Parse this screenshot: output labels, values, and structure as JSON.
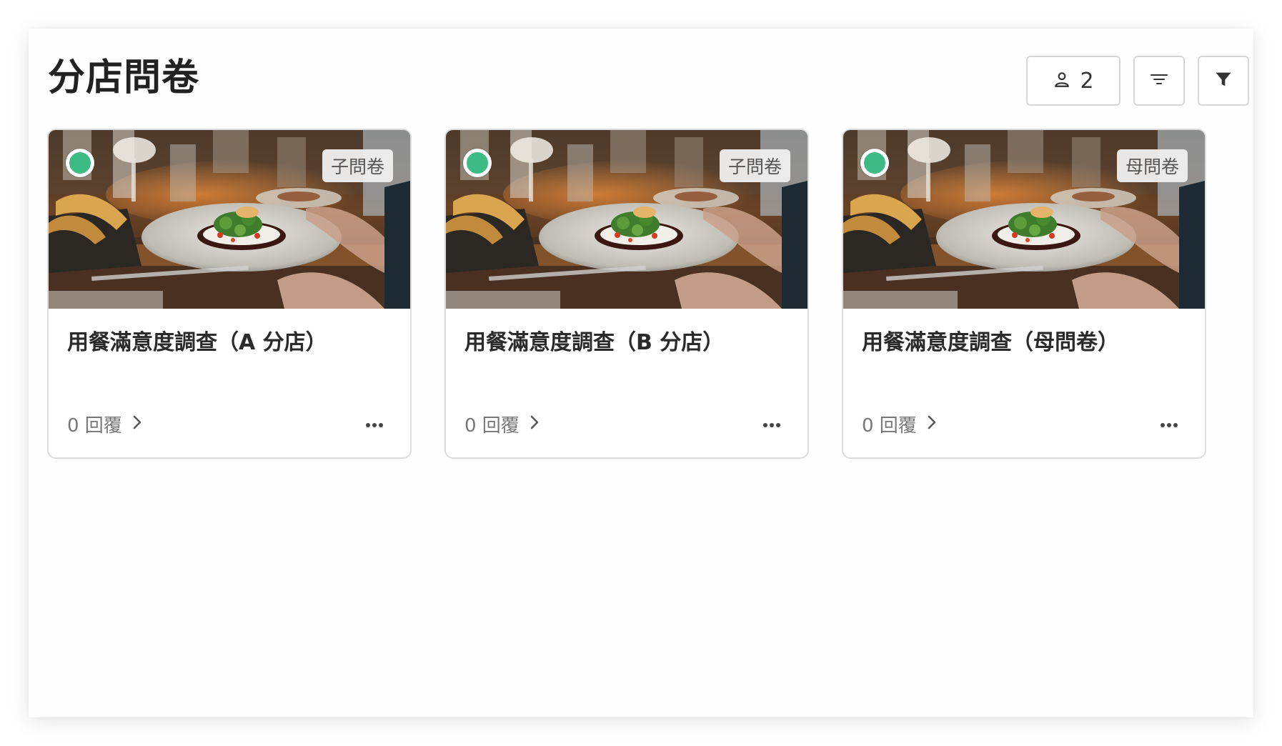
{
  "header": {
    "title": "分店問卷",
    "members_count": "2",
    "members_icon": "person-icon",
    "sort_icon": "sort-lines-icon",
    "filter_icon": "funnel-icon"
  },
  "colors": {
    "status_active": "#3dbb84",
    "badge_bg": "#f0f0f0",
    "border": "#dcdcdc"
  },
  "cards": [
    {
      "title": "用餐滿意度調查（A 分店）",
      "badge": "子問卷",
      "responses": "0 回覆",
      "image": "restaurant-dish-photo"
    },
    {
      "title": "用餐滿意度調查（B 分店）",
      "badge": "子問卷",
      "responses": "0 回覆",
      "image": "restaurant-dish-photo"
    },
    {
      "title": "用餐滿意度調查（母問卷）",
      "badge": "母問卷",
      "responses": "0 回覆",
      "image": "restaurant-dish-photo"
    }
  ]
}
